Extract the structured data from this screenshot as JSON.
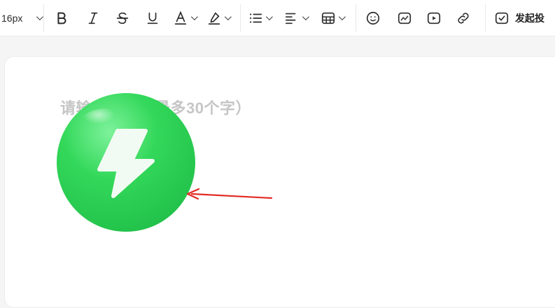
{
  "toolbar": {
    "font_size": "16px",
    "publish_label": "发起投",
    "icons": [
      "bold-icon",
      "italic-icon",
      "strikethrough-icon",
      "underline-icon",
      "font-color-icon",
      "highlight-icon",
      "list-icon",
      "align-icon",
      "table-icon",
      "emoji-icon",
      "image-icon",
      "video-icon",
      "link-icon",
      "checkbox-icon"
    ]
  },
  "editor": {
    "title_placeholder": "请输入标题（最多30个字）"
  },
  "colors": {
    "logo_green": "#2fd553",
    "arrow_red": "#e22b24",
    "placeholder": "#c6c6c6"
  }
}
